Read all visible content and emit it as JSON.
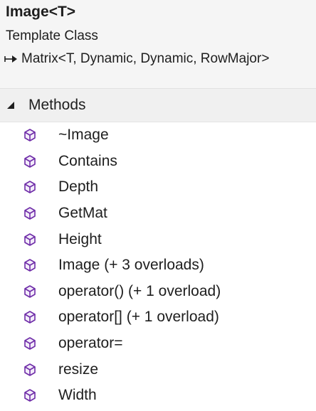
{
  "header": {
    "title": "Image<T>",
    "kind": "Template Class",
    "base_class": "Matrix<T, Dynamic, Dynamic, RowMajor>",
    "base_icon": "inheritance-arrow-icon"
  },
  "methods_section": {
    "label": "Methods",
    "expanded": true,
    "caret_icon": "expanded-triangle-icon",
    "item_icon": "method-cube-icon",
    "icon_color": "#6f2da8",
    "items": [
      {
        "label": "~Image"
      },
      {
        "label": "Contains"
      },
      {
        "label": "Depth"
      },
      {
        "label": "GetMat"
      },
      {
        "label": "Height"
      },
      {
        "label": "Image (+ 3 overloads)"
      },
      {
        "label": "operator() (+ 1 overload)"
      },
      {
        "label": "operator[] (+ 1 overload)"
      },
      {
        "label": "operator="
      },
      {
        "label": "resize"
      },
      {
        "label": "Width"
      }
    ]
  }
}
